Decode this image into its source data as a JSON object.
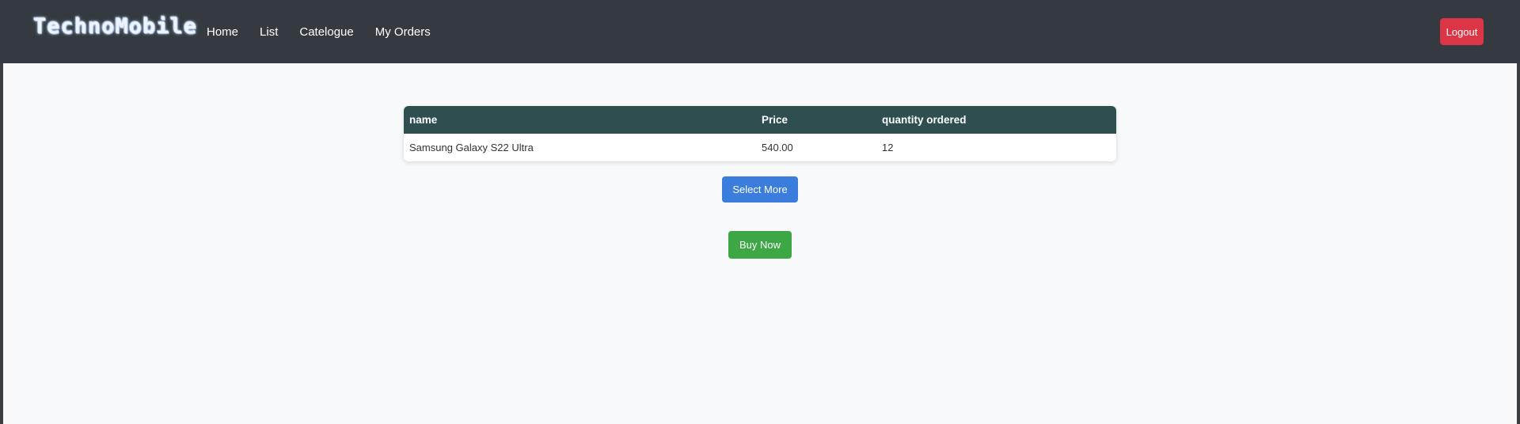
{
  "navbar": {
    "brand": "TechnoMobile",
    "links": [
      {
        "label": "Home"
      },
      {
        "label": "List"
      },
      {
        "label": "Catelogue"
      },
      {
        "label": "My Orders"
      }
    ],
    "logout_label": "Logout"
  },
  "orders_table": {
    "headers": [
      "name",
      "Price",
      "quantity ordered"
    ],
    "rows": [
      {
        "name": "Samsung Galaxy S22 Ultra",
        "price": "540.00",
        "quantity": "12"
      }
    ]
  },
  "actions": {
    "select_more_label": "Select More",
    "buy_now_label": "Buy Now"
  },
  "colors": {
    "navbar_bg": "#343a40",
    "table_header_bg": "#2f4f4f",
    "logout": "#dc3545",
    "select_more": "#3b7ddd",
    "buy_now": "#3ea745",
    "page_bg": "#f8f9fa"
  }
}
